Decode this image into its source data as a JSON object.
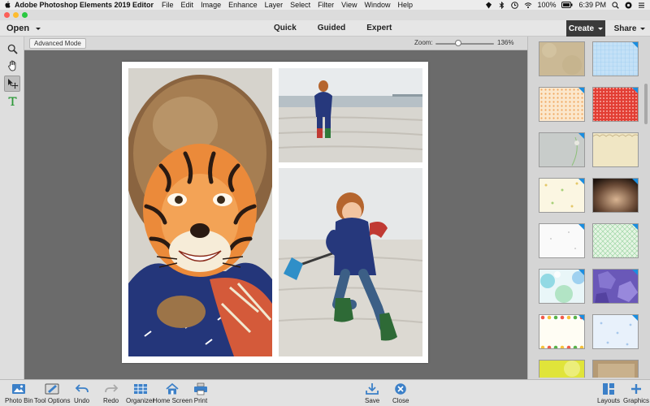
{
  "menubar": {
    "app_name": "Adobe Photoshop Elements 2019 Editor",
    "items": [
      "File",
      "Edit",
      "Image",
      "Enhance",
      "Layer",
      "Select",
      "Filter",
      "View",
      "Window",
      "Help"
    ],
    "battery": "100%",
    "clock": "6:39 PM",
    "icons": [
      "apple-icon",
      "location-icon",
      "bluetooth-icon",
      "clock-icon",
      "wifi-icon",
      "battery-icon",
      "spotlight-icon",
      "control-center-icon",
      "menu-list-icon"
    ]
  },
  "toolbar": {
    "open_label": "Open",
    "modes": [
      "Quick",
      "Guided",
      "Expert"
    ],
    "create_label": "Create",
    "share_label": "Share"
  },
  "tools": [
    "zoom-icon",
    "hand-icon",
    "move-icon",
    "text-icon"
  ],
  "options": {
    "mode_button": "Advanced Mode",
    "zoom_label": "Zoom:",
    "zoom_value": "136%",
    "zoom_level": 0.39
  },
  "bottom_bar": {
    "left": [
      "Photo Bin",
      "Tool Options",
      "Undo",
      "Redo",
      "Organizer",
      "Home Screen",
      "Print"
    ],
    "center": [
      "Save",
      "Close"
    ],
    "right": [
      "Layouts",
      "Graphics"
    ]
  },
  "colors": {
    "accent_blue": "#1a8ee0",
    "create_bg": "#3a3a3a",
    "canvas_bg": "#6b6b6b"
  }
}
